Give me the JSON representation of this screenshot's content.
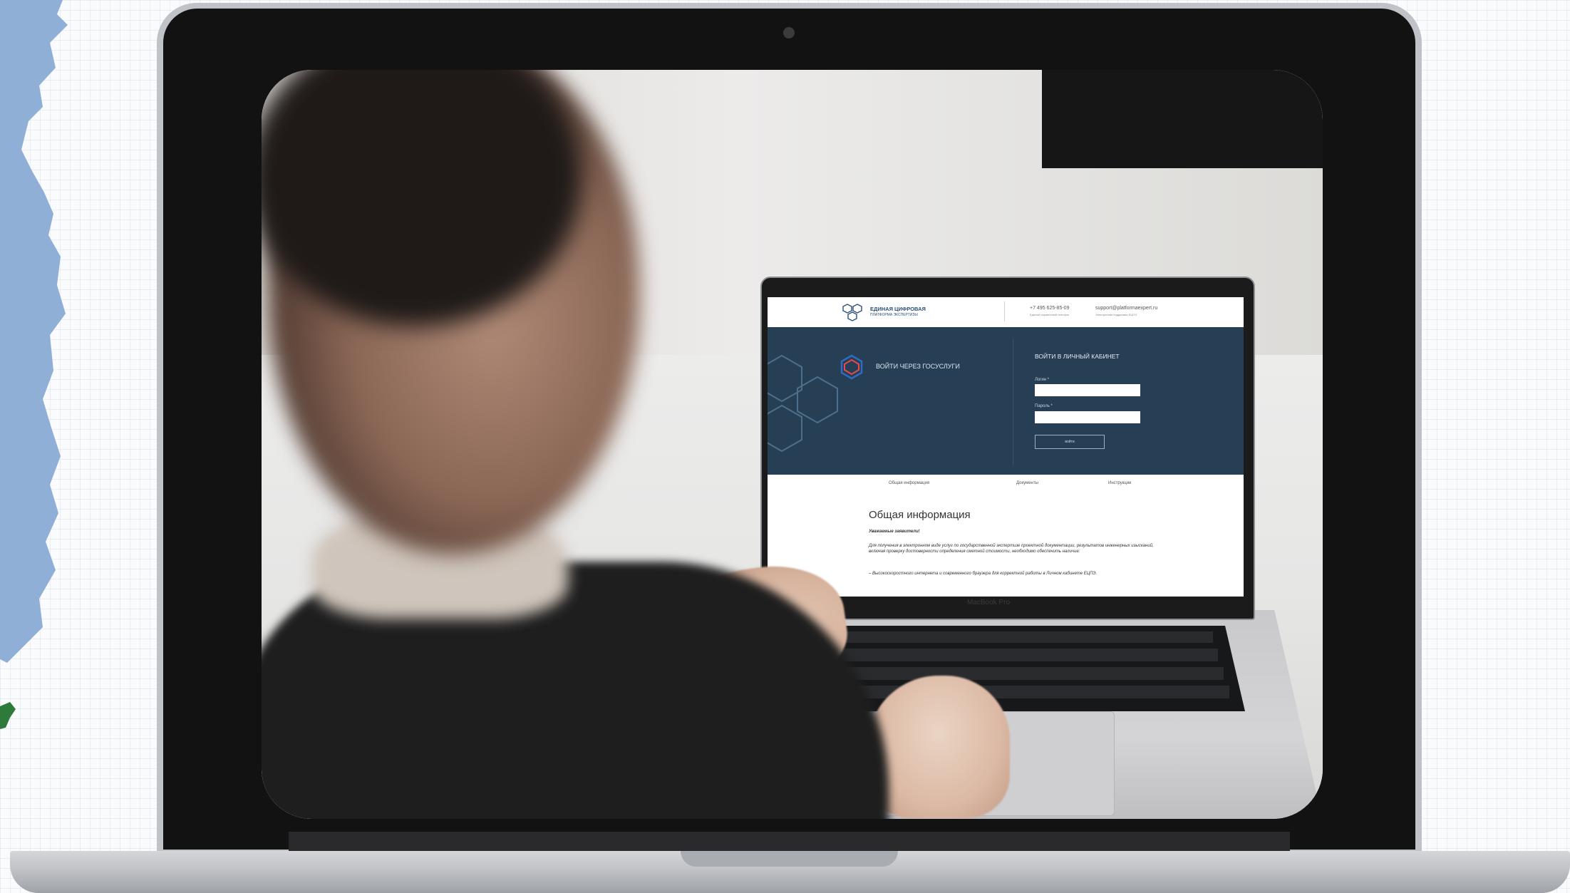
{
  "mockup": {
    "inner_laptop_label": "MacBook Pro",
    "screen": {
      "header": {
        "logo_line1": "ЕДИНАЯ ЦИФРОВАЯ",
        "logo_line2": "ПЛАТФОРМА ЭКСПЕРТИЗЫ",
        "phone": "+7 495 625-85-09",
        "phone_caption": "Единый справочный телефон",
        "email": "support@platformaexpert.ru",
        "email_caption": "Электронная поддержка ЕЦПЭ"
      },
      "hero": {
        "gosuslugi_button": "ВОЙТИ ЧЕРЕЗ ГОСУСЛУГИ",
        "login_title": "ВОЙТИ В ЛИЧНЫЙ КАБИНЕТ",
        "login_label": "Логин *",
        "password_label": "Пароль *",
        "submit_label": "войти"
      },
      "tabs": [
        "Общая информация",
        "Документы",
        "Инструкции"
      ],
      "content": {
        "heading": "Общая информация",
        "p1": "Уважаемые заявители!",
        "p2": "Для получения в электронном виде услуг по государственной экспертизе проектной документации, результатов инженерных изысканий, включая проверку достоверности определения сметной стоимости, необходимо обеспечить наличие:",
        "p3": "– Высокоскоростного интернета и современного браузера для корректной работы в Личном кабинете ЕЦПЭ."
      }
    }
  },
  "colors": {
    "hero_bg": "#273f55",
    "brand_blue": "#2c4f78",
    "bezel": "#121212",
    "aluminum": "#bfc2c7",
    "map_blue": "#8fafd6",
    "map_green": "#2e7a3a"
  }
}
